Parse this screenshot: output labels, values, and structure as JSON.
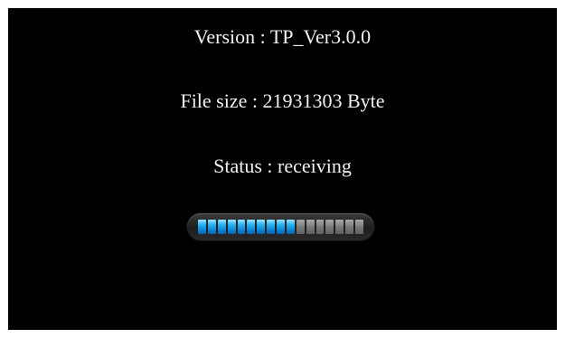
{
  "version_line": "Version : TP_Ver3.0.0",
  "file_size_line": "File size : 21931303 Byte",
  "status_line": "Status : receiving",
  "progress": {
    "segments_total": 17,
    "segments_filled": 10,
    "fill_color": "#29b4f2",
    "empty_color": "#7c7c7c"
  },
  "colors": {
    "background": "#000000",
    "text": "#f2f2f2"
  }
}
